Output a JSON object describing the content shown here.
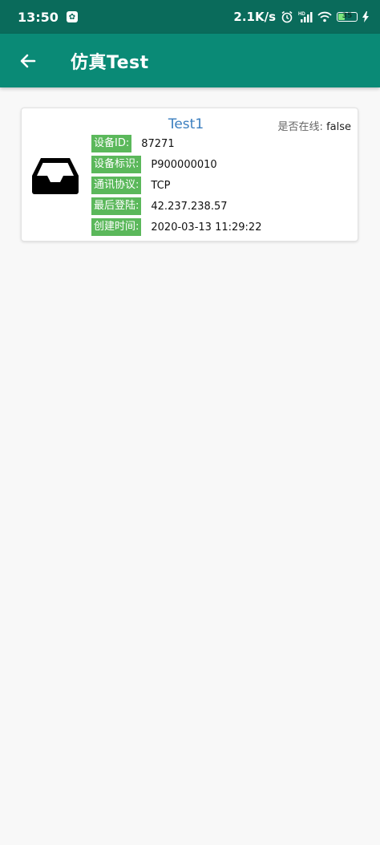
{
  "status_bar": {
    "time": "13:50",
    "speed": "2.1K/s",
    "battery": "35",
    "network_label": "HD",
    "icons": [
      "notification-app-icon",
      "alarm-icon",
      "signal-icon",
      "wifi-icon",
      "battery-icon",
      "charging-icon"
    ]
  },
  "app_bar": {
    "title": "仿真Test",
    "back_icon": "arrow-left-icon"
  },
  "device": {
    "icon": "inbox-tray-icon",
    "name": "Test1",
    "online_label": "是否在线:",
    "online_value": "false",
    "fields": [
      {
        "label": "设备ID:",
        "value": "87271"
      },
      {
        "label": "设备标识:",
        "value": "P900000010"
      },
      {
        "label": "通讯协议:",
        "value": "TCP"
      },
      {
        "label": "最后登陆:",
        "value": "42.237.238.57"
      },
      {
        "label": "创建时间:",
        "value": "2020-03-13 11:29:22"
      }
    ]
  },
  "colors": {
    "status_bar": "#0a6b5b",
    "app_bar": "#0a8a76",
    "tag": "#5bb85b",
    "device_name": "#3a7ebf",
    "background": "#f8f8f8"
  }
}
